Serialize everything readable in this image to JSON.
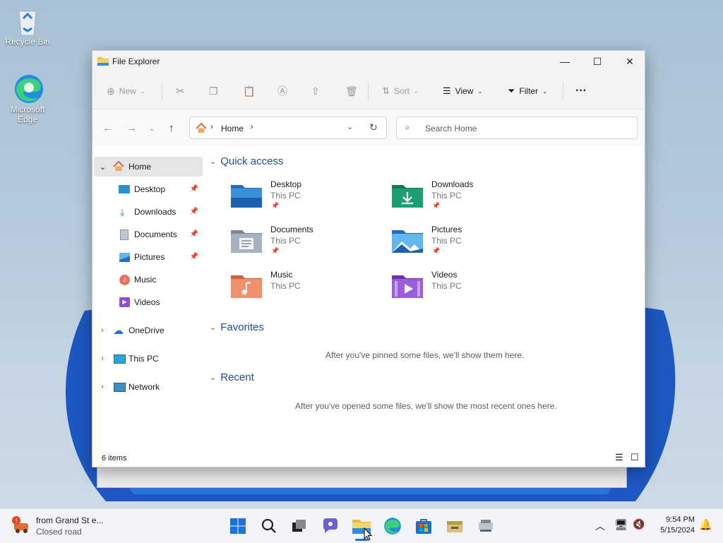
{
  "desktop": {
    "icons": [
      {
        "label": "Recycle Bin"
      },
      {
        "label": "Microsoft Edge"
      }
    ]
  },
  "window": {
    "title": "File Explorer",
    "controls": {
      "minimize": "—",
      "maximize": "☐",
      "close": "✕"
    },
    "toolbar": {
      "new_label": "New",
      "sort_label": "Sort",
      "view_label": "View",
      "filter_label": "Filter",
      "more_label": "···"
    },
    "address": {
      "location": "Home"
    },
    "search": {
      "placeholder": "Search Home"
    },
    "sidebar": {
      "items": [
        {
          "label": "Home"
        },
        {
          "label": "Desktop"
        },
        {
          "label": "Downloads"
        },
        {
          "label": "Documents"
        },
        {
          "label": "Pictures"
        },
        {
          "label": "Music"
        },
        {
          "label": "Videos"
        },
        {
          "label": "OneDrive"
        },
        {
          "label": "This PC"
        },
        {
          "label": "Network"
        }
      ]
    },
    "sections": {
      "quick_access": "Quick access",
      "favorites": "Favorites",
      "recent": "Recent",
      "favorites_empty": "After you've pinned some files, we'll show them here.",
      "recent_empty": "After you've opened some files, we'll show the most recent ones here."
    },
    "quick_access_items": [
      {
        "name": "Desktop",
        "location": "This PC"
      },
      {
        "name": "Downloads",
        "location": "This PC"
      },
      {
        "name": "Documents",
        "location": "This PC"
      },
      {
        "name": "Pictures",
        "location": "This PC"
      },
      {
        "name": "Music",
        "location": "This PC"
      },
      {
        "name": "Videos",
        "location": "This PC"
      }
    ],
    "status": {
      "count": "6 items"
    }
  },
  "taskbar": {
    "news": {
      "title": "from Grand St e...",
      "subtitle": "Closed road"
    },
    "clock": {
      "time": "9:54 PM",
      "date": "5/15/2024"
    }
  },
  "colors": {
    "accent": "#1f4e9c",
    "folder_blue": "#3a8fd6",
    "folder_green": "#1f9e74",
    "folder_orange": "#e87a55",
    "folder_purple": "#8f4fd1"
  }
}
